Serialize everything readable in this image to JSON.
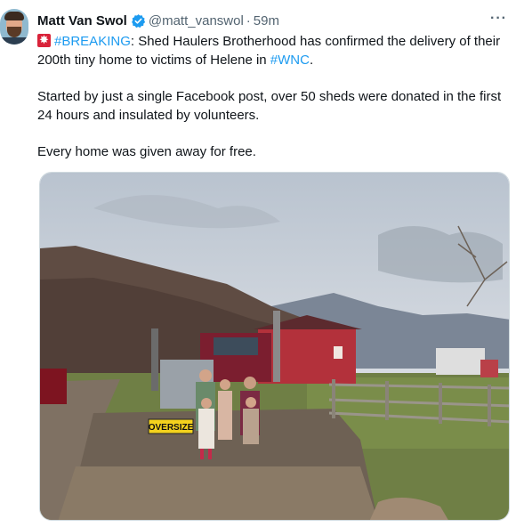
{
  "tweet": {
    "author_name": "Matt Van Swol",
    "handle": "@matt_vanswol",
    "separator": "·",
    "time": "59m",
    "more_label": "···",
    "line1_tag": "#BREAKING",
    "line1_rest": ": Shed Haulers Brotherhood has confirmed the delivery of their 200th tiny home to victims of Helene in ",
    "line1_tag2": "#WNC",
    "line1_end": ".",
    "paragraph2": "Started by just a single Facebook post, over 50 sheds were donated in the first 24 hours and insulated by volunteers.",
    "paragraph3": "Every home was given away for free."
  },
  "photo": {
    "truck_sign": "OVERSIZE"
  },
  "colors": {
    "accent": "#1d9bf0",
    "verified": "#1d9bf0",
    "alert": "#d9233a",
    "muted": "#536471"
  }
}
